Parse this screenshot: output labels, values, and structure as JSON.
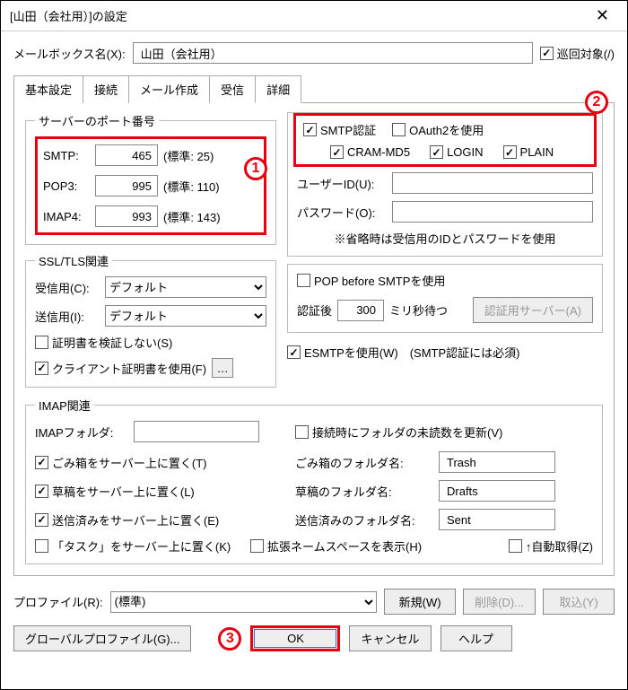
{
  "title": "[山田（会社用）]の設定",
  "mailbox": {
    "label": "メールボックス名(X):",
    "value": "山田（会社用）",
    "circulate_label": "巡回対象(/)",
    "circulate_checked": true
  },
  "tabs": [
    "基本設定",
    "接続",
    "メール作成",
    "受信",
    "詳細"
  ],
  "active_tab": "詳細",
  "port": {
    "legend": "サーバーのポート番号",
    "smtp_label": "SMTP:",
    "smtp_value": "465",
    "smtp_std": "(標準: 25)",
    "pop3_label": "POP3:",
    "pop3_value": "995",
    "pop3_std": "(標準: 110)",
    "imap4_label": "IMAP4:",
    "imap4_value": "993",
    "imap4_std": "(標準: 143)"
  },
  "ssl": {
    "legend": "SSL/TLS関連",
    "recv_label": "受信用(C):",
    "recv_value": "デフォルト",
    "send_label": "送信用(I):",
    "send_value": "デフォルト",
    "no_verify_label": "証明書を検証しない(S)",
    "no_verify_checked": false,
    "client_cert_label": "クライアント証明書を使用(F)",
    "client_cert_checked": true
  },
  "smtpauth": {
    "smtp_auth_label": "SMTP認証",
    "smtp_auth_checked": true,
    "oauth2_label": "OAuth2を使用",
    "oauth2_checked": false,
    "cram_label": "CRAM-MD5",
    "cram_checked": true,
    "login_label": "LOGIN",
    "login_checked": true,
    "plain_label": "PLAIN",
    "plain_checked": true,
    "userid_label": "ユーザーID(U):",
    "userid_value": "",
    "password_label": "パスワード(O):",
    "password_value": "",
    "note": "※省略時は受信用のIDとパスワードを使用"
  },
  "popbefore": {
    "pbs_label": "POP before SMTPを使用",
    "pbs_checked": false,
    "wait_prefix": "認証後",
    "wait_value": "300",
    "wait_suffix": "ミリ秒待つ",
    "server_btn": "認証用サーバー(A)"
  },
  "esmtp": {
    "label": "ESMTPを使用(W)　(SMTP認証には必須)",
    "checked": true
  },
  "imaprel": {
    "legend": "IMAP関連",
    "folder_label": "IMAPフォルダ:",
    "folder_value": "",
    "refresh_label": "接続時にフォルダの未読数を更新(V)",
    "refresh_checked": false,
    "trash_label": "ごみ箱をサーバー上に置く(T)",
    "trash_checked": true,
    "trash_name_label": "ごみ箱のフォルダ名:",
    "trash_name": "Trash",
    "drafts_label": "草稿をサーバー上に置く(L)",
    "drafts_checked": true,
    "drafts_name_label": "草稿のフォルダ名:",
    "drafts_name": "Drafts",
    "sent_label": "送信済みをサーバー上に置く(E)",
    "sent_checked": true,
    "sent_name_label": "送信済みのフォルダ名:",
    "sent_name": "Sent",
    "task_label": "「タスク」をサーバー上に置く(K)",
    "task_checked": false,
    "ext_ns_label": "拡張ネームスペースを表示(H)",
    "ext_ns_checked": false,
    "auto_label": "↑自動取得(Z)",
    "auto_checked": false
  },
  "profile": {
    "label": "プロファイル(R):",
    "value": "(標準)",
    "new_btn": "新規(W)",
    "delete_btn": "削除(D)...",
    "import_btn": "取込(Y)"
  },
  "footer": {
    "global_btn": "グローバルプロファイル(G)...",
    "ok_btn": "OK",
    "cancel_btn": "キャンセル",
    "help_btn": "ヘルプ"
  },
  "callouts": {
    "c1": "1",
    "c2": "2",
    "c3": "3"
  }
}
